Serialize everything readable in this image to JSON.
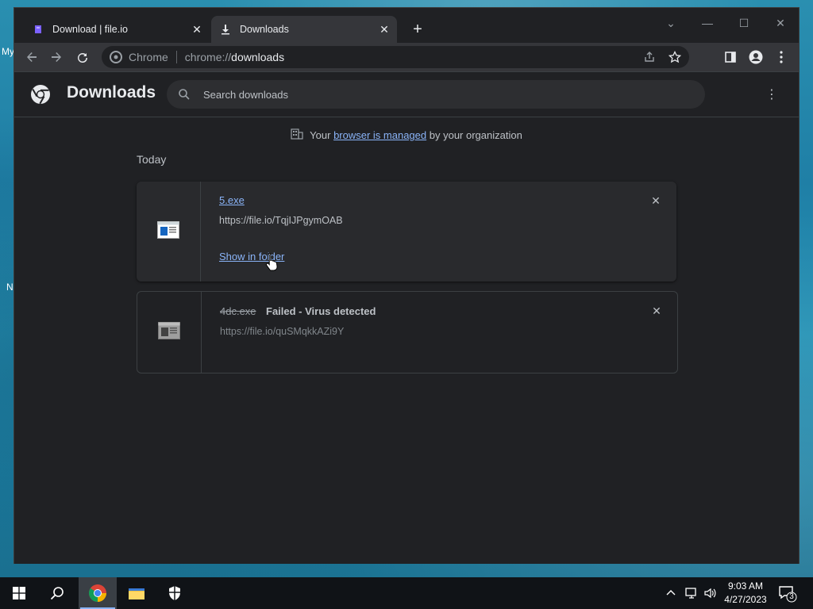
{
  "desktop": {
    "label_top": "My",
    "label_mid": "N"
  },
  "tabs": [
    {
      "title": "Download | file.io",
      "active": false,
      "icon": "fileio-icon"
    },
    {
      "title": "Downloads",
      "active": true,
      "icon": "download-icon"
    }
  ],
  "omnibox": {
    "site_label": "Chrome",
    "scheme": "chrome://",
    "path": "downloads"
  },
  "page": {
    "title": "Downloads",
    "search_placeholder": "Search downloads",
    "managed_prefix": "Your",
    "managed_link": "browser is managed",
    "managed_suffix": "by your organization",
    "section_date": "Today"
  },
  "downloads": [
    {
      "file_name": "5.exe",
      "url": "https://file.io/TqjIJPgymOAB",
      "action": "Show in folder",
      "status": ""
    },
    {
      "file_name": "4dc.exe",
      "url": "https://file.io/quSMqkkAZi9Y",
      "action": "",
      "status": "Failed - Virus detected"
    }
  ],
  "taskbar": {
    "time": "9:03 AM",
    "date": "4/27/2023",
    "notification_count": "3"
  },
  "colors": {
    "accent": "#8ab4f8",
    "bg": "#202124",
    "toolbar": "#35363a"
  }
}
